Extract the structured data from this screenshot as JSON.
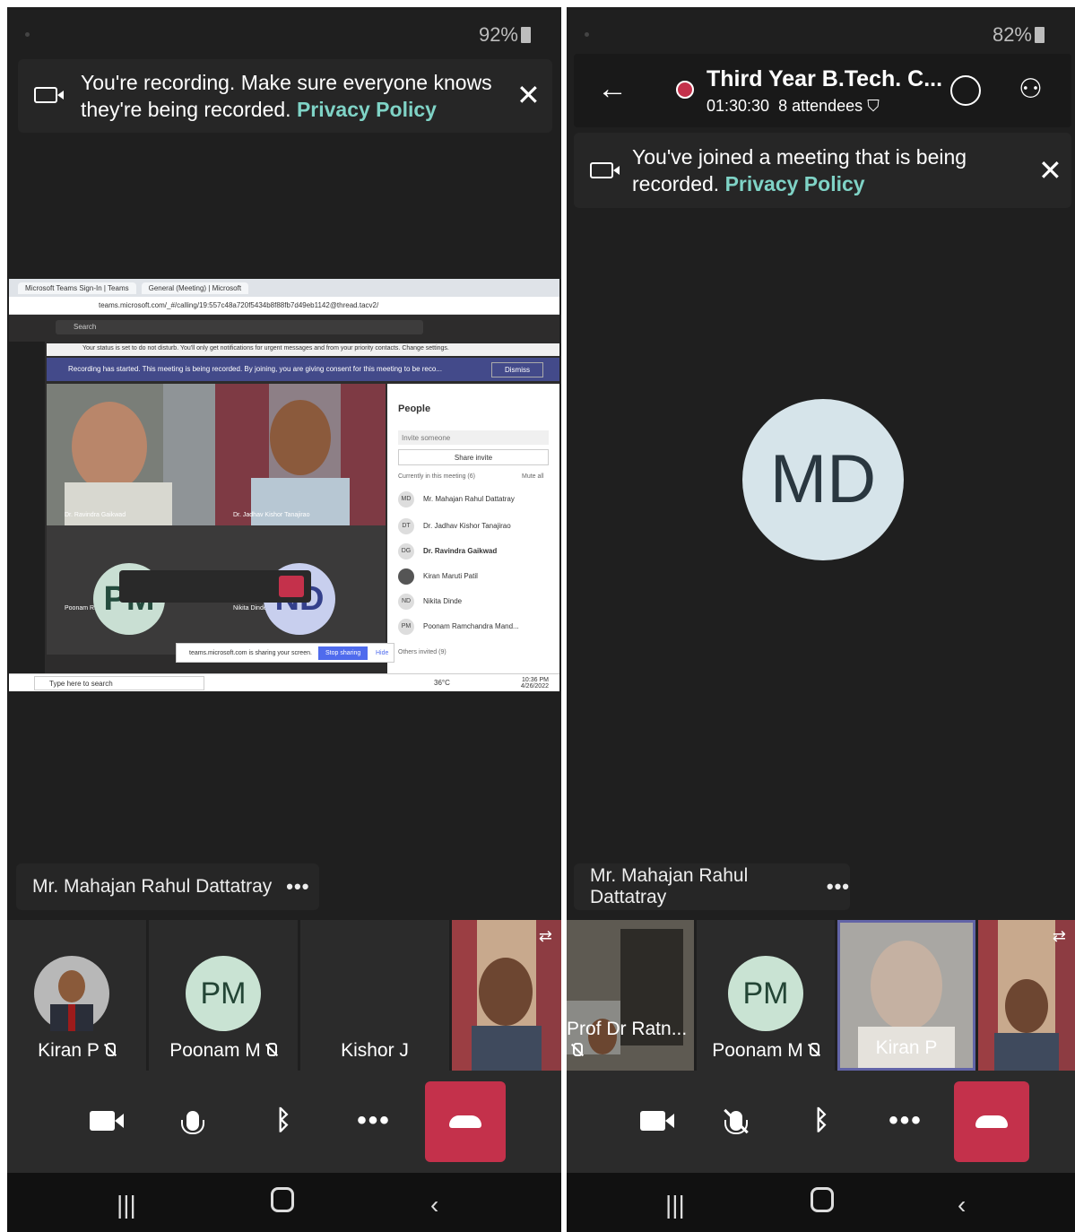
{
  "left": {
    "battery": "92%",
    "banner": {
      "text": "You're recording. Make sure everyone knows they're being recorded.",
      "link": "Privacy Policy"
    },
    "shared_screen": {
      "tabs": [
        "Microsoft Teams Sign-In | Teams",
        "General (Meeting) | Microsoft"
      ],
      "url": "teams.microsoft.com/_#/calling/19:557c48a720f5434b8f88fb7d49eb1142@thread.tacv2/",
      "search": "Search",
      "notice": "Your status is set to do not disturb. You'll only get notifications for urgent messages and from your priority contacts. Change settings.",
      "recording_bar": "Recording has started. This meeting is being recorded. By joining, you are giving consent for this meeting to be reco...",
      "dismiss": "Dismiss",
      "video_labels": [
        "Dr. Ravindra Gaikwad",
        "Dr. Jadhav Kishor Tanajirao",
        "Poonam Ramchandra Mandhare",
        "Nikita Dinde"
      ],
      "avatars": [
        "PM",
        "ND"
      ],
      "people": {
        "title": "People",
        "invite": "Invite someone",
        "share": "Share invite",
        "current": "Currently in this meeting (6)",
        "mute_all": "Mute all",
        "members": [
          {
            "initials": "MD",
            "name": "Mr. Mahajan Rahul Dattatray"
          },
          {
            "initials": "DT",
            "name": "Dr. Jadhav Kishor Tanajirao"
          },
          {
            "initials": "DG",
            "name": "Dr. Ravindra Gaikwad"
          },
          {
            "initials": "",
            "name": "Kiran Maruti Patil"
          },
          {
            "initials": "ND",
            "name": "Nikita Dinde"
          },
          {
            "initials": "PM",
            "name": "Poonam Ramchandra Mand..."
          }
        ],
        "others": "Others invited (9)"
      },
      "share_info": "teams.microsoft.com is sharing your screen.",
      "stop_sharing": "Stop sharing",
      "hide": "Hide",
      "taskbar_search": "Type here to search",
      "temp": "36°C",
      "time": "10:36 PM",
      "date": "4/26/2022"
    },
    "speaker": "Mr. Mahajan Rahul Dattatray",
    "tiles": [
      {
        "name": "Kiran P",
        "initials": ""
      },
      {
        "name": "Poonam M",
        "initials": "PM"
      },
      {
        "name": "Kishor J",
        "initials": ""
      }
    ]
  },
  "right": {
    "battery": "82%",
    "meeting_title": "Third Year B.Tech. C...",
    "duration": "01:30:30",
    "attendees": "8 attendees",
    "banner": {
      "text": "You've joined a meeting that is being recorded.",
      "link": "Privacy Policy"
    },
    "main_avatar": "MD",
    "speaker": "Mr. Mahajan Rahul Dattatray",
    "tiles": [
      {
        "name": "Prof Dr Ratn..."
      },
      {
        "name": "Poonam M",
        "initials": "PM"
      },
      {
        "name": "Kiran P"
      }
    ]
  },
  "colors": {
    "accent_link": "#7fd3c6",
    "hangup": "#c4314b",
    "background": "#1f1f1f"
  }
}
